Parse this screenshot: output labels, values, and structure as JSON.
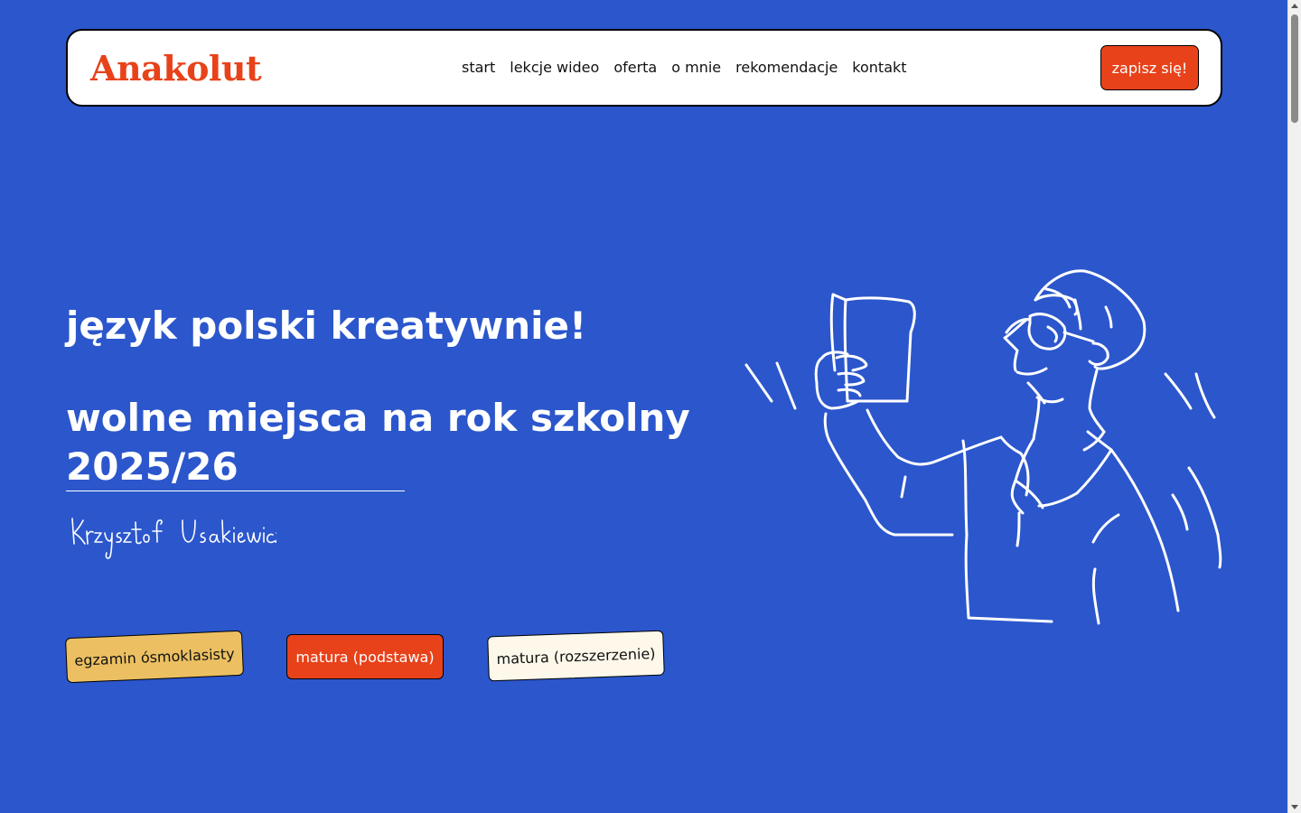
{
  "header": {
    "logo": "Anakolut",
    "nav": [
      "start",
      "lekcje wideo",
      "oferta",
      "o mnie",
      "rekomendacje",
      "kontakt"
    ],
    "cta_label": "zapisz się!"
  },
  "hero": {
    "headline": "język polski kreatywnie!",
    "subheadline": "wolne miejsca na rok szkolny 2025/26",
    "signature": "Krzysztof Usakiewicz"
  },
  "pills": [
    {
      "label": "egzamin ósmoklasisty",
      "color": "#ecc062"
    },
    {
      "label": "matura (podstawa)",
      "color": "#e8421a"
    },
    {
      "label": "matura (rozszerzenie)",
      "color": "#fdf8ea"
    }
  ],
  "colors": {
    "background": "#2b56cc",
    "accent": "#e8421a",
    "yellow": "#ecc062"
  },
  "icons": {
    "illustration": "person-reading-book-illustration",
    "scroll_up": "scroll-up-arrow-icon",
    "scroll_down": "scroll-down-arrow-icon"
  }
}
